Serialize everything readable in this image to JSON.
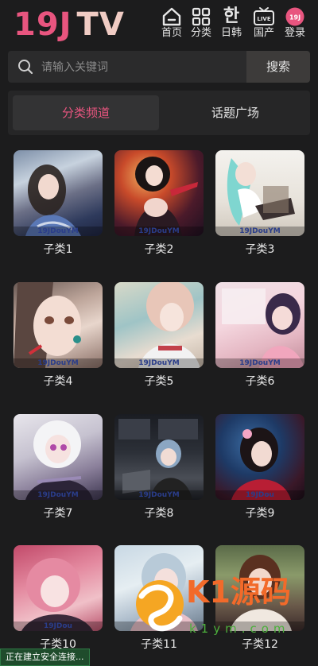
{
  "header": {
    "logo": {
      "number": "19J",
      "suffix": "TV"
    },
    "nav": [
      {
        "label": "首页",
        "icon": "home-icon"
      },
      {
        "label": "分类",
        "icon": "grid-icon"
      },
      {
        "label": "日韩",
        "icon": "korean-char-icon",
        "glyph": "한"
      },
      {
        "label": "国产",
        "icon": "live-tv-icon",
        "glyph": "LIVE"
      },
      {
        "label": "登录",
        "icon": "user-badge-icon",
        "glyph": "19J"
      }
    ]
  },
  "search": {
    "placeholder": "请输入关键词",
    "button_label": "搜索"
  },
  "tabs": [
    {
      "label": "分类频道",
      "active": true
    },
    {
      "label": "话题广场",
      "active": false
    }
  ],
  "categories": [
    {
      "label": "子类1",
      "watermark": "19JDouYM"
    },
    {
      "label": "子类2",
      "watermark": "19JDouYM"
    },
    {
      "label": "子类3",
      "watermark": "19JDouYM"
    },
    {
      "label": "子类4",
      "watermark": "19JDouYM"
    },
    {
      "label": "子类5",
      "watermark": "19JDouYM"
    },
    {
      "label": "子类6",
      "watermark": "19JDouYM"
    },
    {
      "label": "子类7",
      "watermark": "19JDouYM"
    },
    {
      "label": "子类8",
      "watermark": "19JDouYM"
    },
    {
      "label": "子类9",
      "watermark": "19JDou"
    },
    {
      "label": "子类10",
      "watermark": "19JDou"
    },
    {
      "label": "子类11",
      "watermark": ""
    },
    {
      "label": "子类12",
      "watermark": ""
    }
  ],
  "status_bar": {
    "text": "正在建立安全连接..."
  },
  "overlay_logo": {
    "brand": "K1源码",
    "domain": "k1ym.com"
  },
  "colors": {
    "accent": "#e8557f",
    "background": "#1c1c1d",
    "brand_orange": "#f26a2a"
  }
}
